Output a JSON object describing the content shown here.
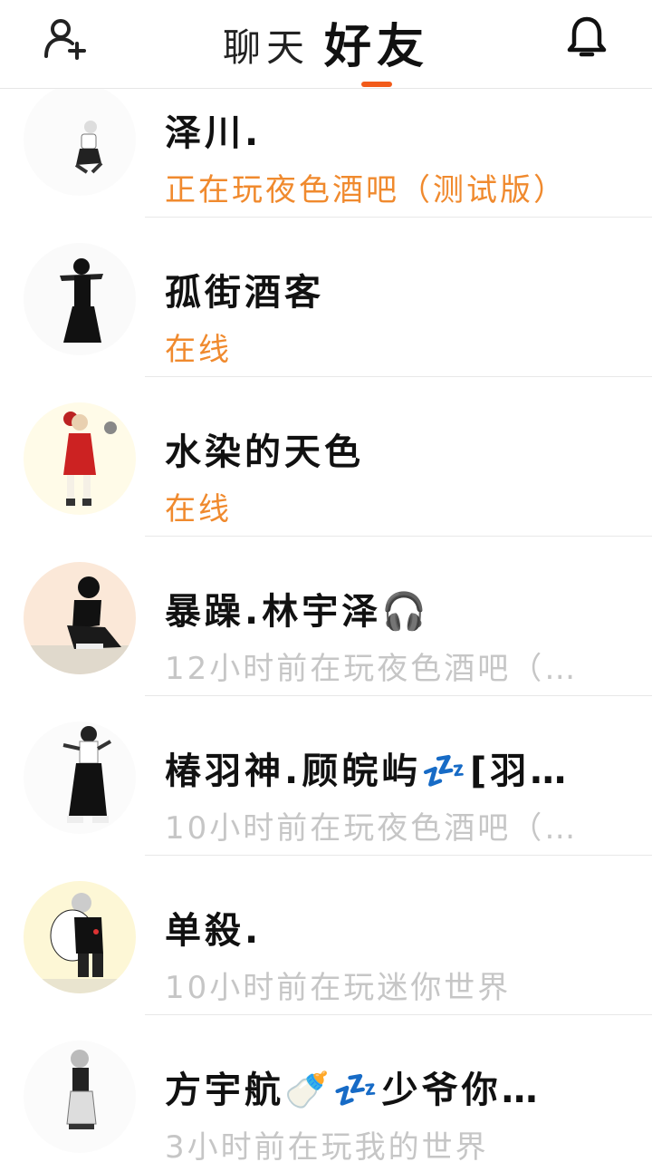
{
  "header": {
    "tab_chat": "聊天",
    "tab_friends": "好友",
    "add_friend_icon": "add-user-icon",
    "notification_icon": "bell-icon",
    "accent_color": "#f25b1a"
  },
  "friends": [
    {
      "name": "泽川.",
      "status": "正在玩夜色酒吧（测试版）",
      "state": "online",
      "avatar_bg": "#ffffff"
    },
    {
      "name": "孤街酒客",
      "status": "在线",
      "state": "online",
      "avatar_bg": "#ffffff"
    },
    {
      "name": "水染的天色",
      "status": "在线",
      "state": "online",
      "avatar_bg": "#fffbe8"
    },
    {
      "name": "暴躁.林宇泽🎧",
      "status": "12小时前在玩夜色酒吧（…",
      "state": "offline",
      "avatar_bg": "#fbe8d8"
    },
    {
      "name": "椿羽神.顾皖屿💤[羽…",
      "status": "10小时前在玩夜色酒吧（…",
      "state": "offline",
      "avatar_bg": "#ffffff"
    },
    {
      "name": "单殺.",
      "status": "10小时前在玩迷你世界",
      "state": "offline",
      "avatar_bg": "#fdf7d6"
    },
    {
      "name": "方宇航🍼💤少爷你…",
      "status": "3小时前在玩我的世界",
      "state": "offline",
      "avatar_bg": "#ffffff"
    }
  ],
  "colors": {
    "online": "#f08a2e",
    "offline": "#c6c6c6"
  }
}
